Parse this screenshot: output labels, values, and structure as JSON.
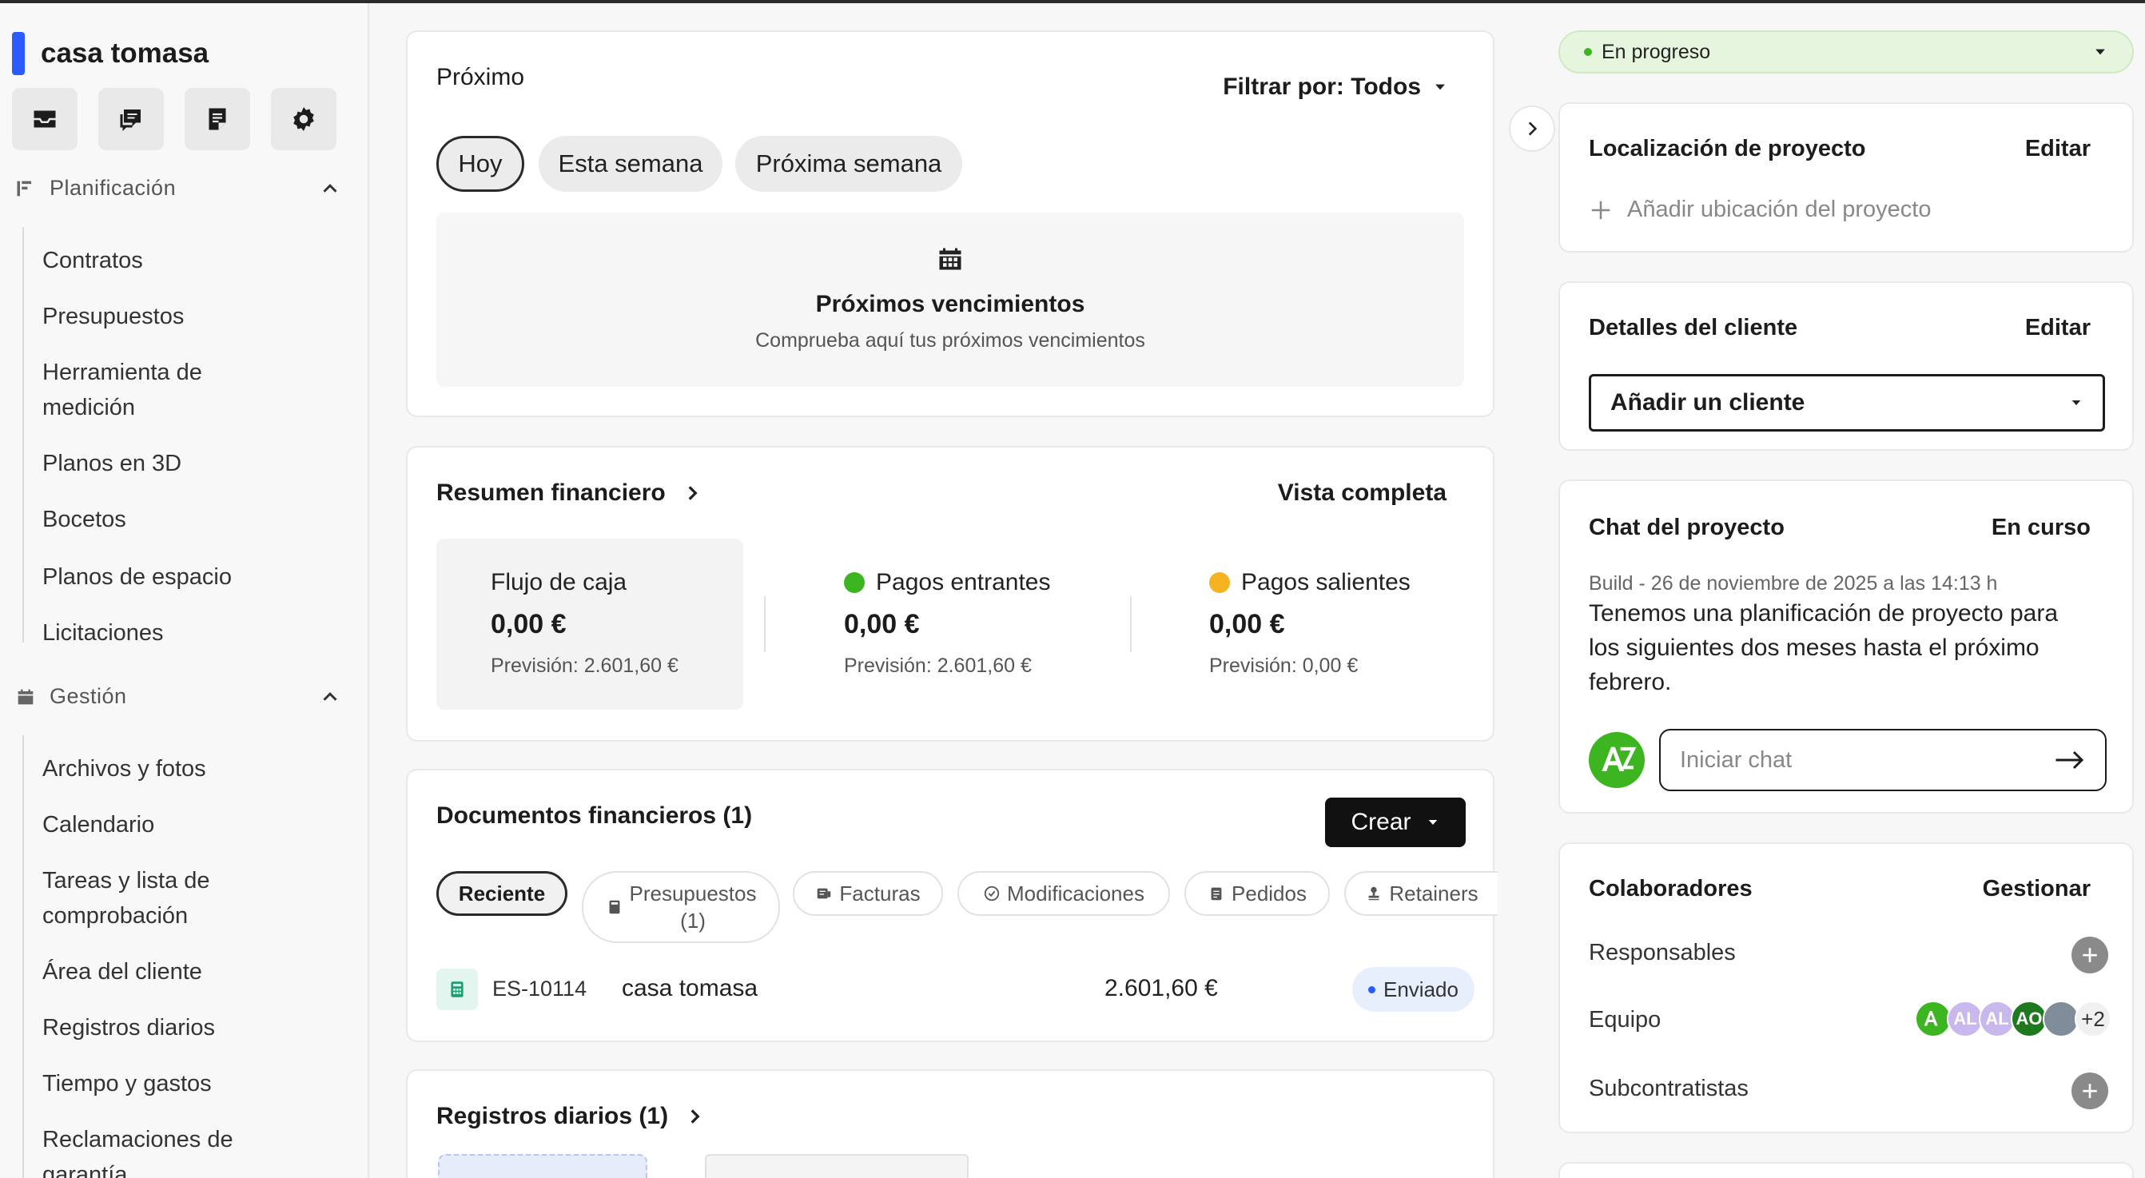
{
  "project": {
    "name": "casa tomasa",
    "accent": "#2a5bff"
  },
  "sidebar": {
    "icons": [
      "inbox-icon",
      "chat-icon",
      "notes-icon",
      "settings-icon"
    ],
    "sections": [
      {
        "label": "Planificación",
        "items": [
          "Contratos",
          "Presupuestos",
          "Herramienta de medición",
          "Planos en 3D",
          "Bocetos",
          "Planos de espacio",
          "Licitaciones"
        ]
      },
      {
        "label": "Gestión",
        "items": [
          "Archivos y fotos",
          "Calendario",
          "Tareas y lista de comprobación",
          "Área del cliente",
          "Registros diarios",
          "Tiempo y gastos",
          "Reclamaciones de garantía"
        ]
      }
    ]
  },
  "upcoming": {
    "title": "Próximo",
    "filter_label": "Filtrar por: Todos",
    "tabs": [
      "Hoy",
      "Esta semana",
      "Próxima semana"
    ],
    "active_tab": "Hoy",
    "empty_title": "Próximos vencimientos",
    "empty_text": "Comprueba aquí tus próximos vencimientos"
  },
  "finance": {
    "title": "Resumen financiero",
    "full_view": "Vista completa",
    "cash_flow": {
      "label": "Flujo de caja",
      "amount": "0,00 €",
      "forecast": "Previsión: 2.601,60 €"
    },
    "incoming": {
      "label": "Pagos entrantes",
      "amount": "0,00 €",
      "forecast": "Previsión: 2.601,60 €",
      "color": "#3cb521"
    },
    "outgoing": {
      "label": "Pagos salientes",
      "amount": "0,00 €",
      "forecast": "Previsión: 0,00 €",
      "color": "#f5b321"
    }
  },
  "documents": {
    "title": "Documentos financieros (1)",
    "create_label": "Crear",
    "tabs": [
      {
        "label": "Reciente",
        "line2": ""
      },
      {
        "label": "Presupuestos",
        "line2": "(1)"
      },
      {
        "label": "Facturas",
        "line2": ""
      },
      {
        "label": "Modificaciones",
        "line2": ""
      },
      {
        "label": "Pedidos",
        "line2": ""
      },
      {
        "label": "Retainers",
        "line2": ""
      }
    ],
    "rows": [
      {
        "id": "ES-10114",
        "name": "casa tomasa",
        "amount": "2.601,60 €",
        "status": "Enviado"
      }
    ]
  },
  "daily_logs": {
    "title": "Registros diarios (1)"
  },
  "right": {
    "status": "En progreso",
    "location": {
      "title": "Localización de proyecto",
      "edit": "Editar",
      "add": "Añadir ubicación del proyecto"
    },
    "client": {
      "title": "Detalles del cliente",
      "edit": "Editar",
      "select": "Añadir un cliente"
    },
    "chat": {
      "title": "Chat del proyecto",
      "status": "En curso",
      "meta": "Build - 26 de noviembre de 2025 a las 14:13 h",
      "message": "Tenemos una planificación de proyecto para los siguientes dos meses hasta el próximo febrero.",
      "placeholder": "Iniciar chat"
    },
    "collaborators": {
      "title": "Colaboradores",
      "manage": "Gestionar",
      "responsables": "Responsables",
      "equipo": "Equipo",
      "subcontratistas": "Subcontratistas",
      "team_avatars": [
        "AL",
        "AL",
        "AO"
      ],
      "more": "+2"
    }
  }
}
